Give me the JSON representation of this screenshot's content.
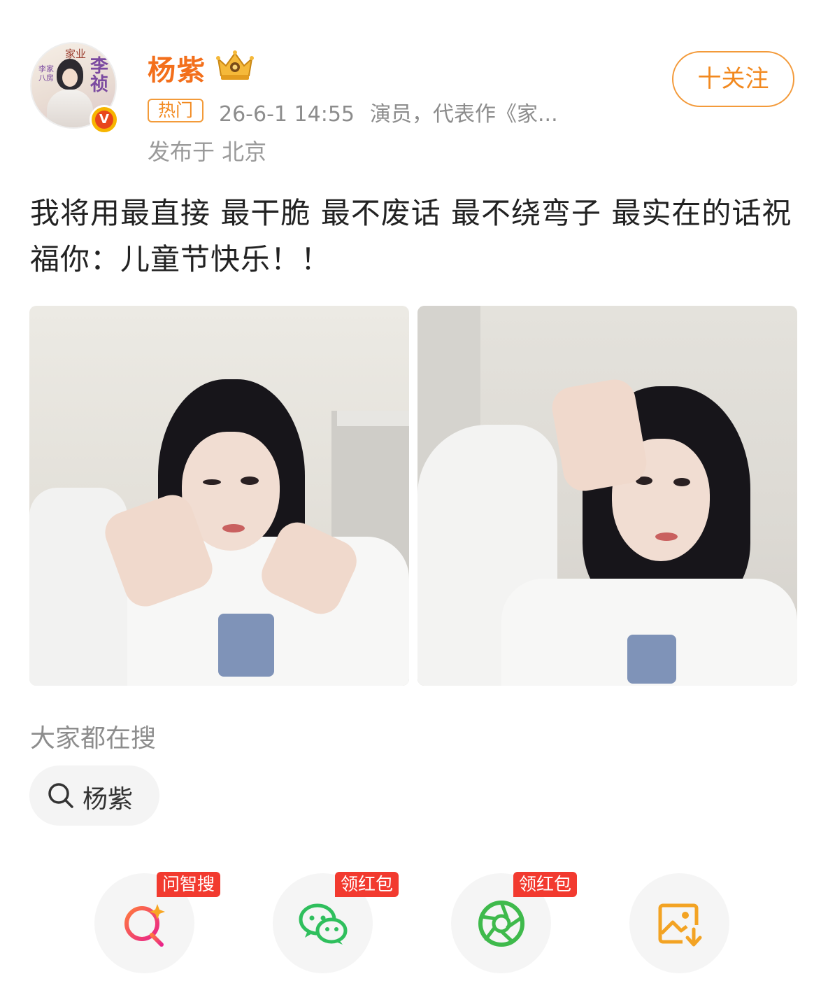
{
  "author": {
    "name": "杨紫",
    "avatar_text": {
      "title": "家业",
      "name": "李祯",
      "subtitle": "李家八房"
    },
    "verified_mark": "V",
    "crown_icon": "crown-icon"
  },
  "post_meta": {
    "badge": "热门",
    "timestamp": "26-6-1 14:55",
    "description": "演员，代表作《家...",
    "location": "发布于 北京"
  },
  "follow_button": {
    "label": "十关注"
  },
  "post": {
    "text": "我将用最直接 最干脆 最不废话 最不绕弯子 最实在的话祝福你：儿童节快乐！！",
    "images": [
      "photo-1",
      "photo-2"
    ]
  },
  "search": {
    "heading": "大家都在搜",
    "chip_label": "杨紫"
  },
  "actions": [
    {
      "icon": "ai-search-icon",
      "badge": "问智搜"
    },
    {
      "icon": "wechat-icon",
      "badge": "领红包"
    },
    {
      "icon": "moments-icon",
      "badge": "领红包"
    },
    {
      "icon": "save-image-icon",
      "badge": ""
    }
  ],
  "colors": {
    "accent_orange": "#f2891f",
    "badge_red": "#f23a2f",
    "wechat_green": "#2fbf5d",
    "text_gray": "#8c8c8c"
  }
}
